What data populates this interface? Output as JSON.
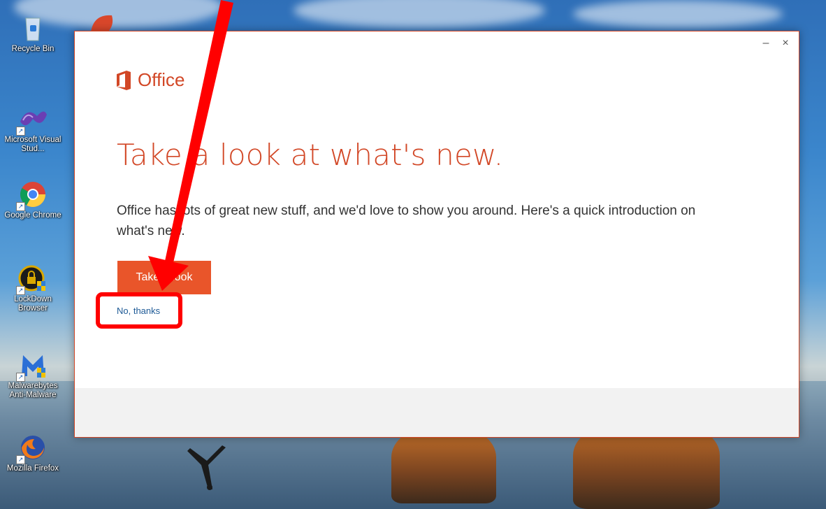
{
  "desktop": {
    "icons": [
      {
        "name": "recycle-bin",
        "label": "Recycle Bin"
      },
      {
        "name": "visual-studio",
        "label": "Microsoft Visual Stud..."
      },
      {
        "name": "google-chrome",
        "label": "Google Chrome"
      },
      {
        "name": "lockdown-browser",
        "label": "LockDown Browser"
      },
      {
        "name": "malwarebytes",
        "label": "Malwarebytes Anti-Malware"
      },
      {
        "name": "mozilla-firefox",
        "label": "Mozilla Firefox"
      }
    ]
  },
  "dialog": {
    "brand": "Office",
    "headline": "Take a look at what's new.",
    "body": "Office has lots of great new stuff, and we'd love to show you around. Here's a quick introduction on what's new.",
    "primary_button": "Take a look",
    "secondary_link": "No, thanks",
    "minimize_label": "–",
    "close_label": "×"
  },
  "colors": {
    "office_orange": "#d24726",
    "button_orange": "#e9552a",
    "link_blue": "#1e5a96",
    "annotation_red": "#ff0000"
  }
}
